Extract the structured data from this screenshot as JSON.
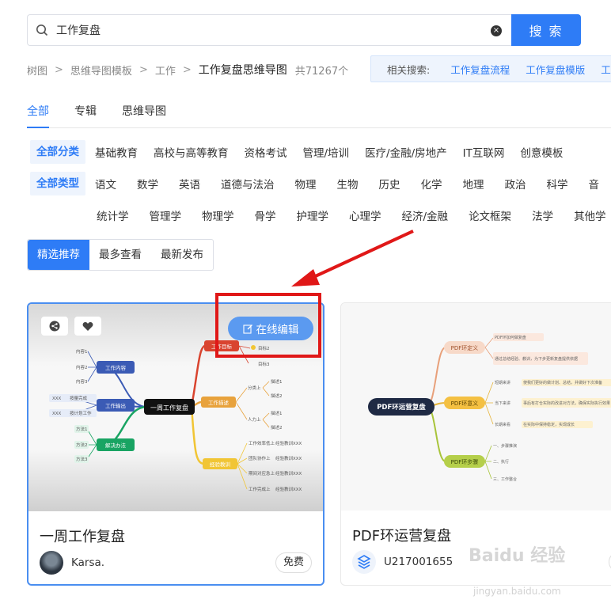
{
  "search": {
    "value": "工作复盘",
    "button_label": "搜 索"
  },
  "breadcrumb": {
    "items": [
      "树图",
      "思维导图模板",
      "工作"
    ],
    "current": "工作复盘思维导图",
    "count": "共71267个"
  },
  "related": {
    "label": "相关搜索:",
    "links": [
      "工作复盘流程",
      "工作复盘模版",
      "工作"
    ]
  },
  "tabs": [
    "全部",
    "专辑",
    "思维导图"
  ],
  "filters": {
    "category_selected": "全部分类",
    "categories": [
      "基础教育",
      "高校与高等教育",
      "资格考试",
      "管理/培训",
      "医疗/金融/房地产",
      "IT互联网",
      "创意模板"
    ],
    "type_selected": "全部类型",
    "types_row1": [
      "语文",
      "数学",
      "英语",
      "道德与法治",
      "物理",
      "生物",
      "历史",
      "化学",
      "地理",
      "政治",
      "科学",
      "音"
    ],
    "types_row2": [
      "统计学",
      "管理学",
      "物理学",
      "骨学",
      "护理学",
      "心理学",
      "经济/金融",
      "论文框架",
      "法学",
      "其他学"
    ]
  },
  "sort": [
    "精选推荐",
    "最多查看",
    "最新发布"
  ],
  "cards": [
    {
      "title": "一周工作复盘",
      "author": "Karsa.",
      "badge": "免费",
      "edit_label": "在线编辑",
      "mindmap": {
        "center": "一周工作复盘",
        "branches": [
          "工作内容",
          "工作输出",
          "解决办法",
          "工作目标",
          "工作描述",
          "经验教训"
        ],
        "leaves_left": [
          "内容1",
          "内容2",
          "内容3",
          "XXX",
          "XXX",
          "方法1",
          "方法2",
          "方法3"
        ],
        "leaves_left_tags": [
          "按量完成",
          "按计划工作"
        ],
        "leaves_target": [
          "目标2",
          "目标3"
        ],
        "leaves_desc_groups": [
          "分类上",
          "人力上"
        ],
        "leaves_desc": [
          "描述1",
          "描述2",
          "描述1",
          "描述2"
        ],
        "leaves_exp": [
          "工作效率低上",
          "团队协作上",
          "期间对应急上",
          "工作完成上"
        ],
        "leaves_exp_tags": [
          "经验教训XXX",
          "经验教训XXX",
          "经验教训XXX",
          "经验教训XXX"
        ]
      }
    },
    {
      "title": "PDF环运营复盘",
      "author": "U217001655",
      "badge": "免费",
      "mindmap": {
        "center": "PDF环运营复盘",
        "branches": [
          "PDF环定义",
          "PDF环意义",
          "PDF环步骤"
        ],
        "leaves_def": [
          "PDF环加何做复盘",
          "通过总结经验、教训，为下步更新复盘提供依据"
        ],
        "leaves_mean": [
          "短期来讲",
          "当下来讲",
          "长期来看"
        ],
        "leaves_mean_desc": [
          "使我们更好的做计划、总结，并做好下次准备",
          "事后有打仓实际的改进对方法，确保实际执行效果",
          "在实际中保持稳定，实现成长"
        ],
        "leaves_steps": [
          "一、步骤推演",
          "二、执行",
          "三、工作整合"
        ]
      }
    }
  ],
  "watermark": {
    "main": "Baidu 经验",
    "sub": "jingyan.baidu.com"
  },
  "colors": {
    "accent": "#2e7cf6",
    "highlight": "#e01818"
  }
}
